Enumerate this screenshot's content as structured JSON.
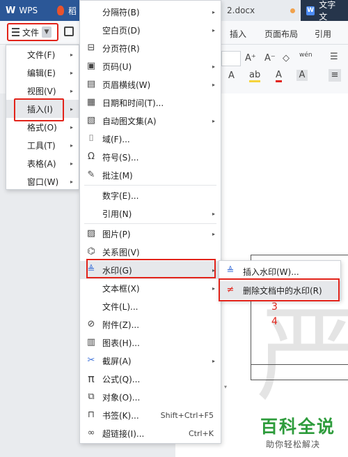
{
  "tabs": {
    "wps": "WPS",
    "second_partial": "稻",
    "doc_partial": "2.docx",
    "text_partial": "文字文"
  },
  "toolbar": {
    "file_label": "文件",
    "ribbon_tabs": [
      "插入",
      "页面布局",
      "引用"
    ],
    "ribbon_row1": [
      "A⁺",
      "A⁻",
      "◇",
      "wén"
    ],
    "ribbon_row2": [
      "A",
      "ab",
      "A",
      "A"
    ]
  },
  "main_menu": [
    {
      "label": "文件(F)",
      "arrow": "▸"
    },
    {
      "label": "编辑(E)",
      "arrow": "▸"
    },
    {
      "label": "视图(V)",
      "arrow": "▸"
    },
    {
      "label": "插入(I)",
      "arrow": "▸"
    },
    {
      "label": "格式(O)",
      "arrow": "▸"
    },
    {
      "label": "工具(T)",
      "arrow": "▸"
    },
    {
      "label": "表格(A)",
      "arrow": "▸"
    },
    {
      "label": "窗口(W)",
      "arrow": "▸"
    }
  ],
  "insert_menu": [
    {
      "label": "分隔符(B)",
      "arrow": "▸",
      "icon": ""
    },
    {
      "label": "空白页(D)",
      "arrow": "▸",
      "icon": ""
    },
    {
      "label": "分页符(R)",
      "arrow": "",
      "icon": "page-break-icon"
    },
    {
      "label": "页码(U)",
      "arrow": "▸",
      "icon": "page-number-icon"
    },
    {
      "label": "页眉横线(W)",
      "arrow": "▸",
      "icon": "header-line-icon"
    },
    {
      "label": "日期和时间(T)...",
      "arrow": "",
      "icon": "calendar-icon"
    },
    {
      "label": "自动图文集(A)",
      "arrow": "▸",
      "icon": "autotext-icon"
    },
    {
      "label": "域(F)...",
      "arrow": "",
      "icon": "field-icon"
    },
    {
      "label": "符号(S)...",
      "arrow": "",
      "icon": "omega-icon"
    },
    {
      "label": "批注(M)",
      "arrow": "",
      "icon": "comment-icon"
    },
    {
      "label": "数字(E)...",
      "arrow": "",
      "icon": ""
    },
    {
      "label": "引用(N)",
      "arrow": "▸",
      "icon": ""
    },
    {
      "label": "图片(P)",
      "arrow": "▸",
      "icon": "picture-icon"
    },
    {
      "label": "关系图(V)",
      "arrow": "",
      "icon": "relation-icon"
    },
    {
      "label": "水印(G)",
      "arrow": "▸",
      "icon": "watermark-icon"
    },
    {
      "label": "文本框(X)",
      "arrow": "▸",
      "icon": ""
    },
    {
      "label": "文件(L)...",
      "arrow": "",
      "icon": ""
    },
    {
      "label": "附件(Z)...",
      "arrow": "",
      "icon": "attachment-icon"
    },
    {
      "label": "图表(H)...",
      "arrow": "",
      "icon": "chart-icon"
    },
    {
      "label": "截屏(A)",
      "arrow": "▸",
      "icon": "screenshot-icon"
    },
    {
      "label": "公式(Q)...",
      "arrow": "",
      "icon": "formula-icon"
    },
    {
      "label": "对象(O)...",
      "arrow": "",
      "icon": "object-icon"
    },
    {
      "label": "书签(K)...",
      "arrow": "",
      "icon": "bookmark-icon",
      "shortcut": "Shift+Ctrl+F5"
    },
    {
      "label": "超链接(I)...",
      "arrow": "",
      "icon": "hyperlink-icon",
      "shortcut": "Ctrl+K"
    }
  ],
  "watermark_menu": [
    {
      "label": "插入水印(W)...",
      "icon": "insert-watermark-icon"
    },
    {
      "label": "删除文档中的水印(R)",
      "icon": "remove-watermark-icon"
    }
  ],
  "annotations": {
    "step3": "3",
    "step4": "4"
  },
  "document": {
    "watermark_glyph": "严"
  },
  "brand": {
    "title": "百科全说",
    "subtitle": "助你轻松解决"
  },
  "colors": {
    "highlight": "#e2231a",
    "tab_blue": "#2b5797",
    "brand_green": "#2e9c3c"
  }
}
